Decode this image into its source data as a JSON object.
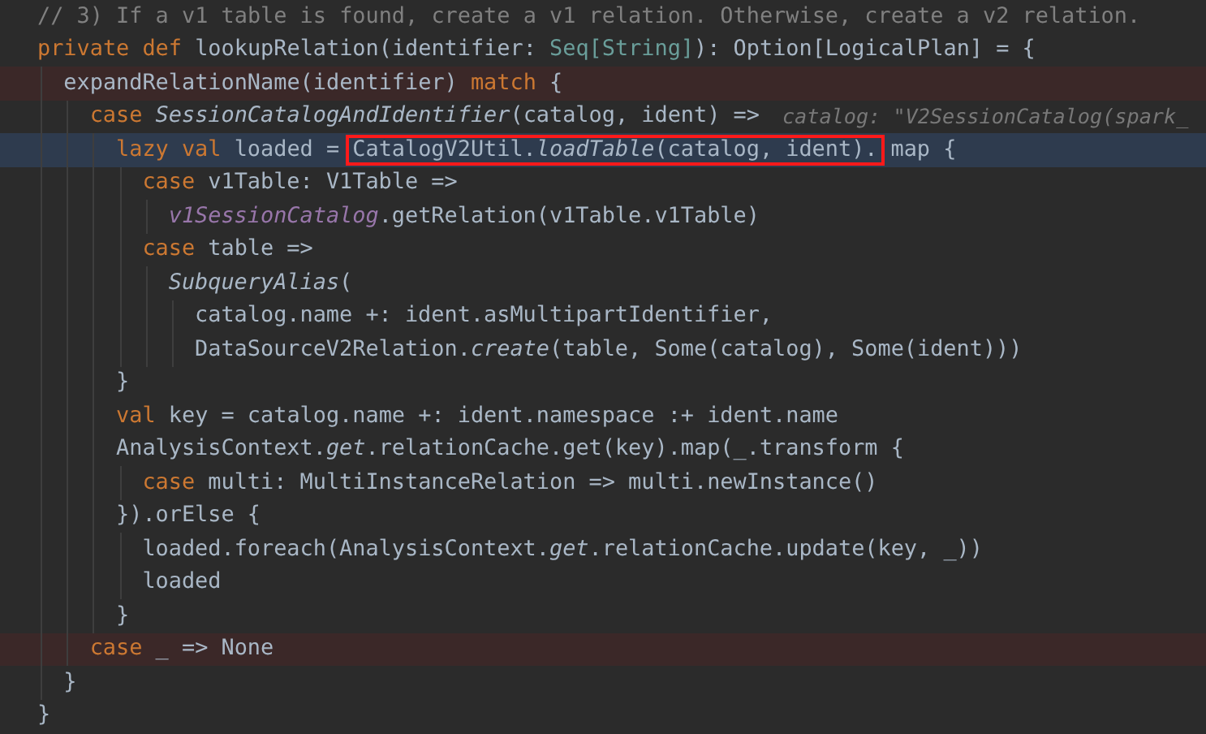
{
  "editor": {
    "lines": [
      {
        "error": false,
        "current": false,
        "tokens": [
          {
            "text": "// 3) If a v1 table is found, create a v1 relation. Otherwise, create a v2 relation.",
            "kind": "comment"
          }
        ]
      },
      {
        "error": false,
        "current": false,
        "tokens": [
          {
            "text": "private def ",
            "kind": "keyword"
          },
          {
            "text": "lookupRelation(identifier: ",
            "kind": "plain"
          },
          {
            "text": "Seq[String]",
            "kind": "type"
          },
          {
            "text": "): Option[LogicalPlan] = {",
            "kind": "plain"
          }
        ],
        "children": [
          {
            "error": true,
            "current": false,
            "tokens": [
              {
                "text": "expandRelationName(identifier) ",
                "kind": "plain"
              },
              {
                "text": "match",
                "kind": "keyword"
              },
              {
                "text": " {",
                "kind": "plain"
              }
            ],
            "children": [
              {
                "error": false,
                "current": false,
                "tokens": [
                  {
                    "text": "case ",
                    "kind": "keyword"
                  },
                  {
                    "text": "SessionCatalogAndIdentifier",
                    "kind": "italic"
                  },
                  {
                    "text": "(catalog, ident) =>",
                    "kind": "plain"
                  }
                ],
                "hint": "catalog: \"V2SessionCatalog(spark_",
                "children": [
                  {
                    "error": false,
                    "current": true,
                    "tokens": [
                      {
                        "text": "lazy val ",
                        "kind": "keyword"
                      },
                      {
                        "text": "loaded = ",
                        "kind": "plain"
                      },
                      {
                        "text": "CatalogV2Util.",
                        "kind": "plain",
                        "boxed": true
                      },
                      {
                        "text": "loadTable",
                        "kind": "italic",
                        "boxed": true
                      },
                      {
                        "text": "(catalog, ident).",
                        "kind": "plain",
                        "boxed": true
                      },
                      {
                        "text": "map {",
                        "kind": "plain"
                      }
                    ],
                    "children": [
                      {
                        "error": false,
                        "current": false,
                        "tokens": [
                          {
                            "text": "case ",
                            "kind": "keyword"
                          },
                          {
                            "text": "v1Table: V1Table =>",
                            "kind": "plain"
                          }
                        ],
                        "children": [
                          {
                            "error": false,
                            "current": false,
                            "tokens": [
                              {
                                "text": "v1SessionCatalog",
                                "kind": "field"
                              },
                              {
                                "text": ".getRelation(v1Table.v1Table)",
                                "kind": "plain"
                              }
                            ]
                          }
                        ]
                      },
                      {
                        "error": false,
                        "current": false,
                        "tokens": [
                          {
                            "text": "case ",
                            "kind": "keyword"
                          },
                          {
                            "text": "table =>",
                            "kind": "plain"
                          }
                        ],
                        "children": [
                          {
                            "error": false,
                            "current": false,
                            "tokens": [
                              {
                                "text": "SubqueryAlias",
                                "kind": "italic"
                              },
                              {
                                "text": "(",
                                "kind": "plain"
                              }
                            ],
                            "children": [
                              {
                                "error": false,
                                "current": false,
                                "tokens": [
                                  {
                                    "text": "catalog.name +: ident.asMultipartIdentifier,",
                                    "kind": "plain"
                                  }
                                ]
                              },
                              {
                                "error": false,
                                "current": false,
                                "tokens": [
                                  {
                                    "text": "DataSourceV2Relation.",
                                    "kind": "plain"
                                  },
                                  {
                                    "text": "create",
                                    "kind": "italic"
                                  },
                                  {
                                    "text": "(table, Some(catalog), Some(ident)))",
                                    "kind": "plain"
                                  }
                                ]
                              }
                            ]
                          }
                        ]
                      }
                    ]
                  },
                  {
                    "error": false,
                    "current": false,
                    "tokens": [
                      {
                        "text": "}",
                        "kind": "plain"
                      }
                    ]
                  },
                  {
                    "error": false,
                    "current": false,
                    "tokens": [
                      {
                        "text": "val ",
                        "kind": "keyword"
                      },
                      {
                        "text": "key = catalog.name +: ident.namespace :+ ident.name",
                        "kind": "plain"
                      }
                    ]
                  },
                  {
                    "error": false,
                    "current": false,
                    "tokens": [
                      {
                        "text": "AnalysisContext.",
                        "kind": "plain"
                      },
                      {
                        "text": "get",
                        "kind": "italic"
                      },
                      {
                        "text": ".relationCache.get(key).map(_.transform {",
                        "kind": "plain"
                      }
                    ],
                    "children": [
                      {
                        "error": false,
                        "current": false,
                        "tokens": [
                          {
                            "text": "case ",
                            "kind": "keyword"
                          },
                          {
                            "text": "multi: MultiInstanceRelation => multi.newInstance()",
                            "kind": "plain"
                          }
                        ]
                      }
                    ]
                  },
                  {
                    "error": false,
                    "current": false,
                    "tokens": [
                      {
                        "text": "}).orElse {",
                        "kind": "plain"
                      }
                    ],
                    "children": [
                      {
                        "error": false,
                        "current": false,
                        "tokens": [
                          {
                            "text": "loaded.foreach(AnalysisContext.",
                            "kind": "plain"
                          },
                          {
                            "text": "get",
                            "kind": "italic"
                          },
                          {
                            "text": ".relationCache.update(key, _))",
                            "kind": "plain"
                          }
                        ]
                      },
                      {
                        "error": false,
                        "current": false,
                        "tokens": [
                          {
                            "text": "loaded",
                            "kind": "plain"
                          }
                        ]
                      }
                    ]
                  },
                  {
                    "error": false,
                    "current": false,
                    "tokens": [
                      {
                        "text": "}",
                        "kind": "plain"
                      }
                    ]
                  }
                ]
              },
              {
                "error": true,
                "current": false,
                "tokens": [
                  {
                    "text": "case ",
                    "kind": "keyword"
                  },
                  {
                    "text": "_ => None",
                    "kind": "plain"
                  }
                ]
              }
            ]
          },
          {
            "error": false,
            "current": false,
            "tokens": [
              {
                "text": "}",
                "kind": "plain"
              }
            ]
          }
        ]
      },
      {
        "error": false,
        "current": false,
        "tokens": [
          {
            "text": "}",
            "kind": "plain"
          }
        ]
      }
    ]
  }
}
